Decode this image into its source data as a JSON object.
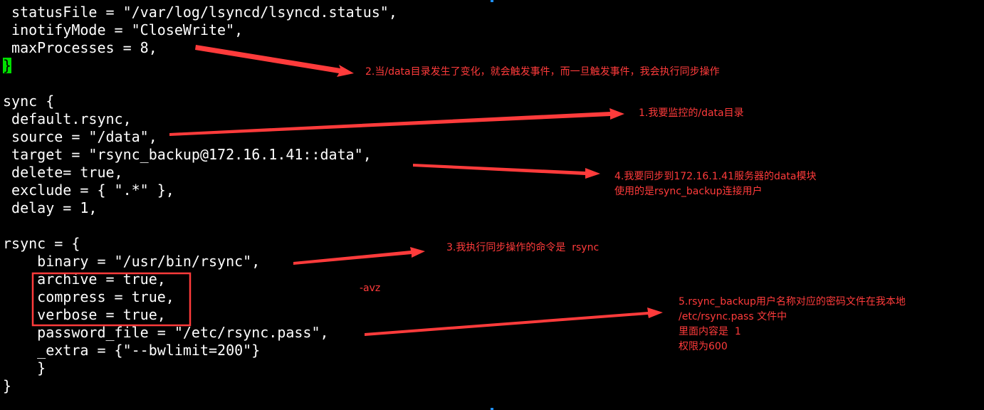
{
  "colors": {
    "background": "#000000",
    "code_text": "#ffffff",
    "cursor": "#00e000",
    "annotation": "#ff3b3b"
  },
  "code_lines": [
    " statusFile = \"/var/log/lsyncd/lsyncd.status\",",
    " inotifyMode = \"CloseWrite\",",
    " maxProcesses = 8,",
    "",
    "",
    "sync {",
    " default.rsync,",
    " source = \"/data\",",
    " target = \"rsync_backup@172.16.1.41::data\",",
    " delete= true,",
    " exclude = { \".*\" },",
    " delay = 1,",
    "",
    "rsync = {",
    "    binary = \"/usr/bin/rsync\",",
    "    archive = true,",
    "    compress = true,",
    "    verbose = true,",
    "    password_file = \"/etc/rsync.pass\",",
    "    _extra = {\"--bwlimit=200\"}",
    "    }",
    "}"
  ],
  "cursor_char": "}",
  "annotations": {
    "note_2": "2.当/data目录发生了变化，就会触发事件，而一旦触发事件，我会执行同步操作",
    "note_1": "1.我要监控的/data目录",
    "note_4": "4.我要同步到172.16.1.41服务器的data模块\n使用的是rsync_backup连接用户",
    "note_3": "3.我执行同步操作的命令是  rsync",
    "note_avz": "-avz",
    "note_5": "5.rsync_backup用户名称对应的密码文件在我本地\n/etc/rsync.pass 文件中\n里面内容是  1\n权限为600"
  }
}
